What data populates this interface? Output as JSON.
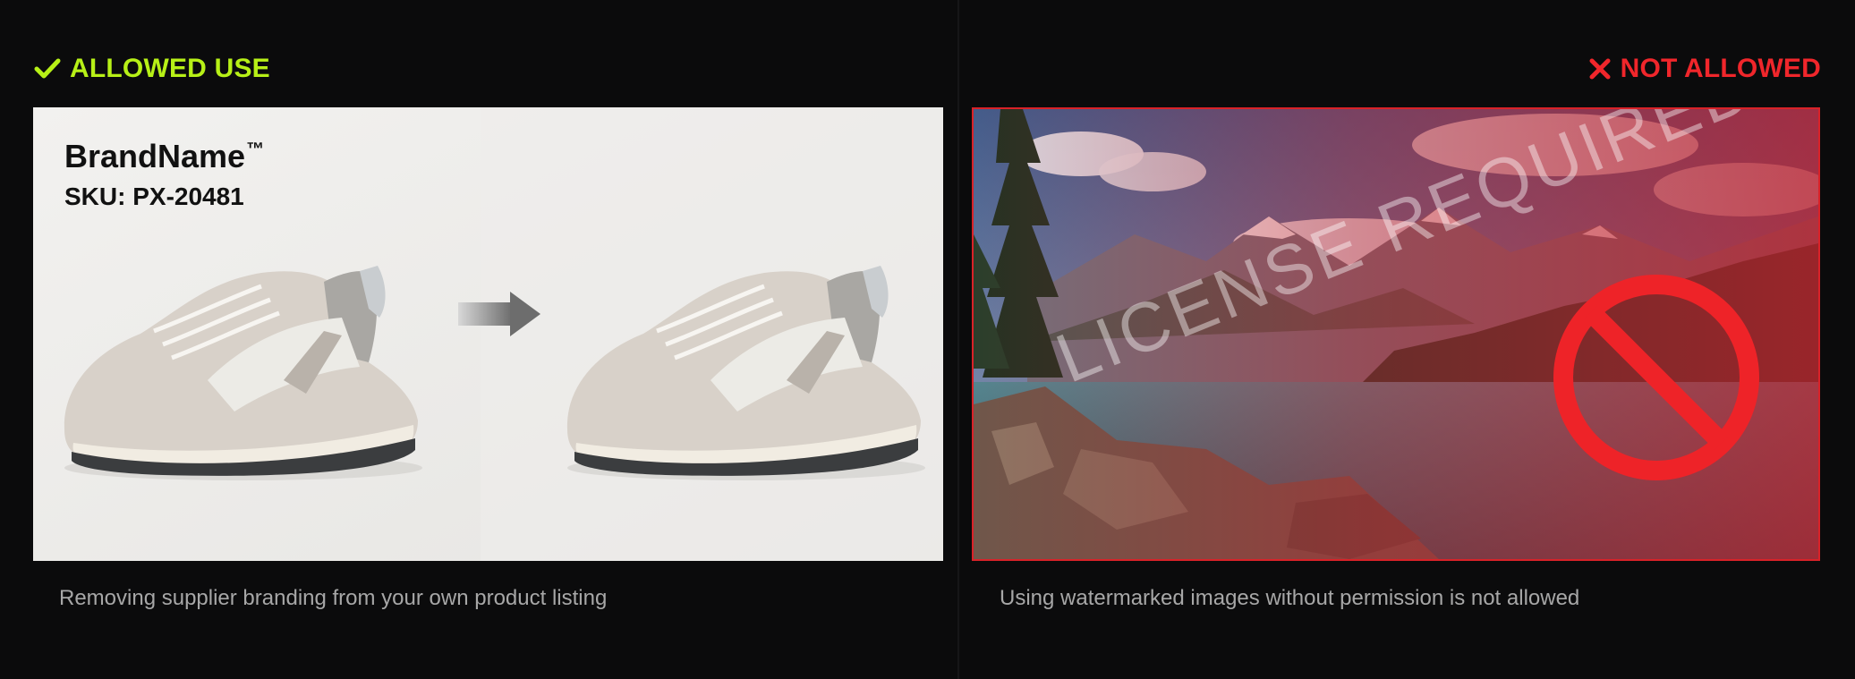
{
  "allowed": {
    "heading": "ALLOWED USE",
    "icon": "check-icon",
    "color": "#b7f017",
    "brand_name": "BrandName",
    "trademark": "™",
    "sku": "SKU: PX-20481",
    "caption": "Removing supplier branding from your own product listing"
  },
  "not_allowed": {
    "heading": "NOT ALLOWED",
    "icon": "x-icon",
    "color": "#f0262b",
    "watermark": "LICENSE REQUIRED",
    "caption": "Using watermarked images without permission is not allowed"
  }
}
